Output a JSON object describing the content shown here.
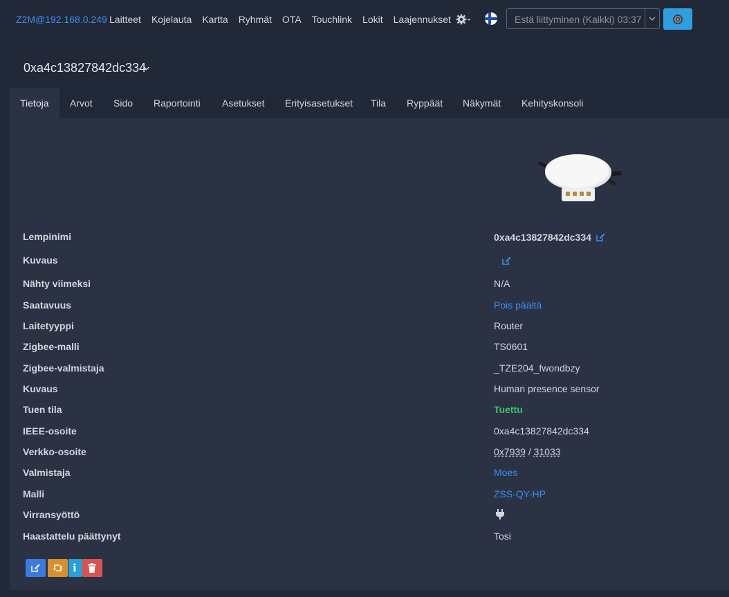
{
  "navbar": {
    "brand": "Z2M@192.168.0.249",
    "links": [
      "Laitteet",
      "Kojelauta",
      "Kartta",
      "Ryhmät",
      "OTA",
      "Touchlink",
      "Lokit",
      "Laajennukset"
    ],
    "settings_icon": "gear-icon",
    "language_flag": "finland-flag-icon",
    "permit_join": "Estä liittyminen (Kaikki) 03:37",
    "permit_menu_icon": "chevron-down-icon",
    "permit_target_icon": "shield-icon"
  },
  "device": {
    "title": "0xa4c13827842dc334"
  },
  "tabs": [
    "Tietoja",
    "Arvot",
    "Sido",
    "Raportointi",
    "Asetukset",
    "Erityisasetukset",
    "Tila",
    "Ryppäät",
    "Näkymät",
    "Kehityskonsoli"
  ],
  "active_tab": "Tietoja",
  "info": [
    {
      "label": "Lempinimi",
      "value": "0xa4c13827842dc334"
    },
    {
      "label": "Kuvaus",
      "value": ""
    },
    {
      "label": "Nähty viimeksi",
      "value": "N/A"
    },
    {
      "label": "Saatavuus",
      "value": "Pois päältä"
    },
    {
      "label": "Laitetyyppi",
      "value": "Router"
    },
    {
      "label": "Zigbee-malli",
      "value": "TS0601"
    },
    {
      "label": "Zigbee-valmistaja",
      "value": "_TZE204_fwondbzy"
    },
    {
      "label": "Kuvaus",
      "value": "Human presence sensor"
    },
    {
      "label": "Tuen tila",
      "value": "Tuettu"
    },
    {
      "label": "IEEE-osoite",
      "value": "0xa4c13827842dc334"
    },
    {
      "label": "Verkko-osoite",
      "value_hex": "0x7939",
      "separator": " / ",
      "value_dec": "31033"
    },
    {
      "label": "Valmistaja",
      "value": "Moes"
    },
    {
      "label": "Malli",
      "value": "ZSS-QY-HP"
    },
    {
      "label": "Virransyöttö",
      "value_icon": "plug-icon"
    },
    {
      "label": "Haastattelu päättynyt",
      "value": "Tosi"
    }
  ],
  "actions": {
    "edit_icon": "edit-icon",
    "rename_icon": "retweet-icon",
    "info_text": "i",
    "delete_icon": "trash-icon"
  },
  "colors": {
    "background": "#212838",
    "panel": "#2a3244",
    "link": "#3f8ff0",
    "supported": "#3ec06b",
    "primary_button": "#3b7ae0",
    "warning_button": "#d7902d",
    "info_button": "#2a9fd8",
    "danger_button": "#d9534f"
  }
}
